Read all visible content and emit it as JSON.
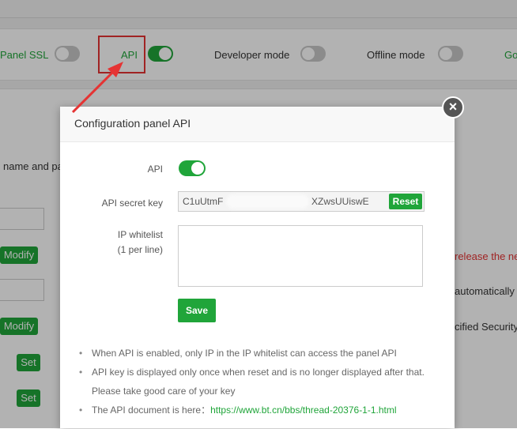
{
  "toolbar": {
    "panel_ssl_label": "Panel SSL",
    "api_label": "API",
    "developer_mode_label": "Developer mode",
    "offline_mode_label": "Offline mode",
    "go_label": "Go"
  },
  "background": {
    "name_label": "name and pa",
    "modify_label": "Modify",
    "set_label": "Set",
    "release_text": "release the ne",
    "automatic_text": "automatically",
    "security_text": "cified Security"
  },
  "modal": {
    "title": "Configuration panel API",
    "api_label": "API",
    "secret_key_label": "API secret key",
    "secret_key_start": "C1uUtmF",
    "secret_key_end": "XZwsUUiswE",
    "reset_label": "Reset",
    "ip_whitelist_label": "IP whitelist",
    "ip_whitelist_hint": "(1 per line)",
    "ip_whitelist_value": "",
    "save_label": "Save",
    "notes": {
      "note1": "When API is enabled, only IP in the IP whitelist can access the panel API",
      "note2": "API key is displayed only once when reset and is no longer displayed after that. Please take good care of your key",
      "note3_prefix": "The API document is here：",
      "note3_link": "https://www.bt.cn/bbs/thread-20376-1-1.html"
    },
    "close_symbol": "×"
  },
  "colors": {
    "accent": "#20a53a",
    "annotation": "#e53333"
  }
}
